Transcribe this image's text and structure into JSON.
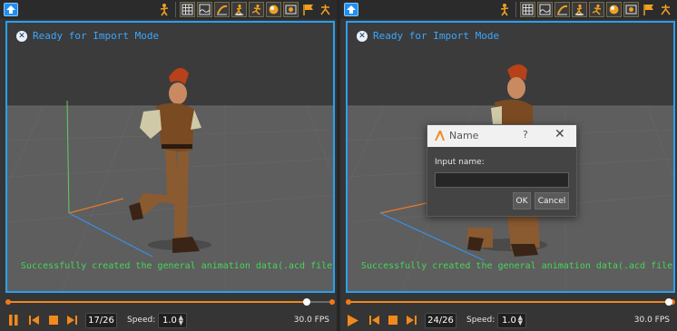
{
  "colors": {
    "accent": "#2aa0f0",
    "orange": "#f08a1c",
    "success_text": "#45d65a",
    "status_text": "#3aa7ff"
  },
  "toolbar": {
    "home_icon": "home-up-arrow-icon",
    "tools": [
      "character-pose-icon",
      "grid-icon",
      "terrain-icon",
      "skate-icon",
      "walk-icon",
      "run-icon",
      "ball-icon",
      "capture-icon",
      "flag-icon",
      "skeleton-icon"
    ]
  },
  "left": {
    "status": "Ready for Import Mode",
    "success": "Successfully created the general animation data(.acd file)",
    "frame": "17/26",
    "progress": 0.92,
    "speed_label": "Speed:",
    "speed": "1.0",
    "fps": "30.0 FPS"
  },
  "right": {
    "status": "Ready for Import Mode",
    "success": "Successfully created the general animation data(.acd file)",
    "frame": "24/26",
    "progress": 0.985,
    "speed_label": "Speed:",
    "speed": "1.0",
    "fps": "30.0 FPS"
  },
  "dialog": {
    "title": "Name",
    "help": "?",
    "close": "✕",
    "input_label": "Input name:",
    "input_value": "",
    "ok": "OK",
    "cancel": "Cancel"
  }
}
